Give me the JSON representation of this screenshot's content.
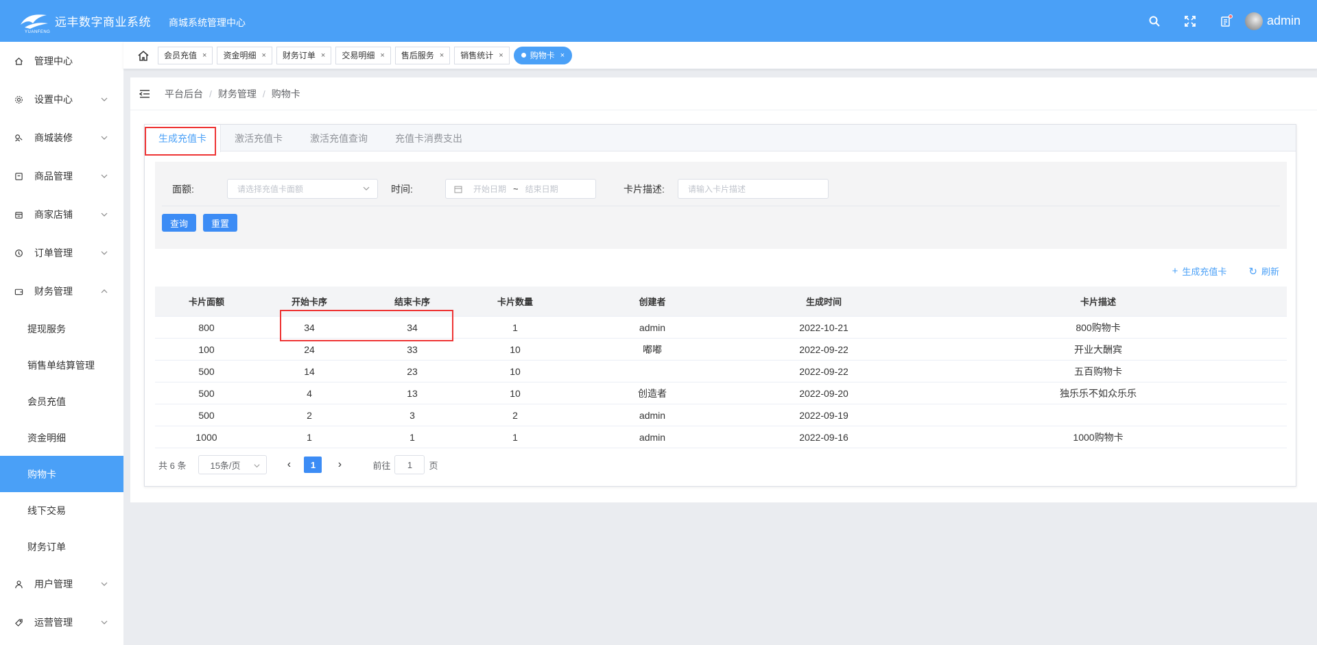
{
  "header": {
    "logo_text": "远丰数字商业系统",
    "logo_sub": "YUANFENG",
    "subtitle": "商城系统管理中心",
    "username": "admin"
  },
  "sidebar": {
    "items": [
      {
        "label": "管理中心",
        "icon": "home-icon"
      },
      {
        "label": "设置中心",
        "icon": "gear-icon"
      },
      {
        "label": "商城装修",
        "icon": "brush-icon"
      },
      {
        "label": "商品管理",
        "icon": "box-icon"
      },
      {
        "label": "商家店铺",
        "icon": "shop-icon"
      },
      {
        "label": "订单管理",
        "icon": "order-icon"
      },
      {
        "label": "财务管理",
        "icon": "wallet-icon"
      }
    ],
    "sub_items": [
      "提现服务",
      "销售单结算管理",
      "会员充值",
      "资金明细",
      "购物卡",
      "线下交易",
      "财务订单"
    ],
    "bottom_items": [
      {
        "label": "用户管理",
        "icon": "user-icon"
      },
      {
        "label": "运营管理",
        "icon": "tag-icon"
      }
    ]
  },
  "tagbar": {
    "tags": [
      "会员充值",
      "资金明细",
      "财务订单",
      "交易明细",
      "售后服务",
      "销售统计"
    ],
    "active_tag": "购物卡"
  },
  "breadcrumb": [
    "平台后台",
    "财务管理",
    "购物卡"
  ],
  "tabs": [
    "生成充值卡",
    "激活充值卡",
    "激活充值查询",
    "充值卡消费支出"
  ],
  "filter": {
    "amount_label": "面额:",
    "amount_placeholder": "请选择充值卡面额",
    "time_label": "时间:",
    "date_start_placeholder": "开始日期",
    "date_sep": "~",
    "date_end_placeholder": "结束日期",
    "desc_label": "卡片描述:",
    "desc_placeholder": "请输入卡片描述",
    "search_btn": "查询",
    "reset_btn": "重置"
  },
  "actions": {
    "generate": "生成充值卡",
    "refresh": "刷新"
  },
  "table": {
    "headers": [
      "卡片面额",
      "开始卡序",
      "结束卡序",
      "卡片数量",
      "创建者",
      "生成时间",
      "卡片描述"
    ],
    "rows": [
      [
        "800",
        "34",
        "34",
        "1",
        "admin",
        "2022-10-21",
        "800购物卡"
      ],
      [
        "100",
        "24",
        "33",
        "10",
        "嘟嘟",
        "2022-09-22",
        "开业大酬宾"
      ],
      [
        "500",
        "14",
        "23",
        "10",
        "",
        "2022-09-22",
        "五百购物卡"
      ],
      [
        "500",
        "4",
        "13",
        "10",
        "创造者",
        "2022-09-20",
        "独乐乐不如众乐乐"
      ],
      [
        "500",
        "2",
        "3",
        "2",
        "admin",
        "2022-09-19",
        ""
      ],
      [
        "1000",
        "1",
        "1",
        "1",
        "admin",
        "2022-09-16",
        "1000购物卡"
      ]
    ]
  },
  "pager": {
    "total": "共 6 条",
    "page_size": "15条/页",
    "prev": "‹",
    "current": "1",
    "next": "›",
    "goto_label": "前往",
    "goto_value": "1",
    "page_suffix": "页"
  }
}
